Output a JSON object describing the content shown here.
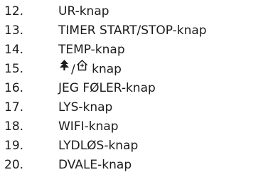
{
  "items": [
    {
      "number": "12.",
      "label": "UR-knap"
    },
    {
      "number": "13.",
      "label": "TIMER START/STOP-knap"
    },
    {
      "number": "14.",
      "label": "TEMP-knap"
    },
    {
      "number": "15.",
      "label_separator": "/",
      "label_suffix": " knap",
      "icons": [
        "tree-icon",
        "house-icon"
      ]
    },
    {
      "number": "16.",
      "label": "JEG FØLER-knap"
    },
    {
      "number": "17.",
      "label": "LYS-knap"
    },
    {
      "number": "18.",
      "label": "WIFI-knap"
    },
    {
      "number": "19.",
      "label": "LYDLØS-knap"
    },
    {
      "number": "20.",
      "label": "DVALE-knap"
    }
  ]
}
